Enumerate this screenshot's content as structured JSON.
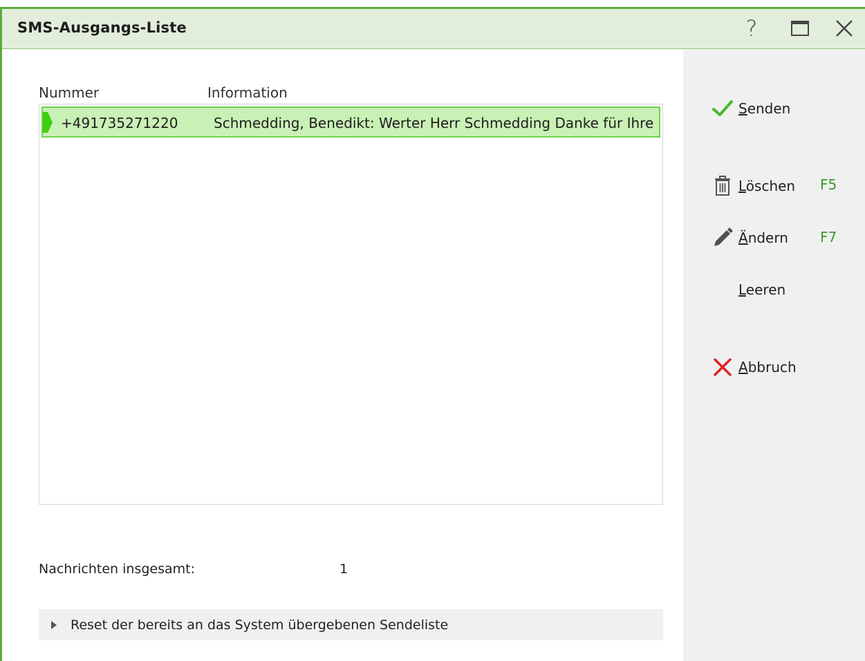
{
  "window": {
    "title": "SMS-Ausgangs-Liste",
    "help_glyph": "?"
  },
  "list": {
    "columns": [
      "Nummer",
      "Information"
    ],
    "rows": [
      {
        "number": "+491735271220",
        "information": "Schmedding, Benedikt: Werter Herr Schmedding Danke für Ihre"
      }
    ]
  },
  "summary": {
    "total_label": "Nachrichten insgesamt:",
    "total_value": "1"
  },
  "reset_section": {
    "label": "Reset der bereits an das System übergebenen Sendeliste"
  },
  "actions": [
    {
      "id": "senden",
      "accel": "S",
      "rest": "enden",
      "icon": "checkmark-icon",
      "hotkey": ""
    },
    {
      "id": "loeschen",
      "accel": "L",
      "rest": "öschen",
      "icon": "trash-icon",
      "hotkey": "F5"
    },
    {
      "id": "aendern",
      "accel": "Ä",
      "rest": "ndern",
      "icon": "pencil-icon",
      "hotkey": "F7"
    },
    {
      "id": "leeren",
      "accel": "L",
      "rest": "eeren",
      "icon": "",
      "hotkey": ""
    },
    {
      "id": "abbruch",
      "accel": "A",
      "rest": "bbruch",
      "icon": "cancel-x-icon",
      "hotkey": ""
    }
  ],
  "colors": {
    "accent_green": "#5cab3c",
    "selection_fill": "#c9f0b5",
    "selection_border": "#6fd14c",
    "hotkey_green": "#3a9a2a",
    "cancel_red": "#e02020"
  }
}
